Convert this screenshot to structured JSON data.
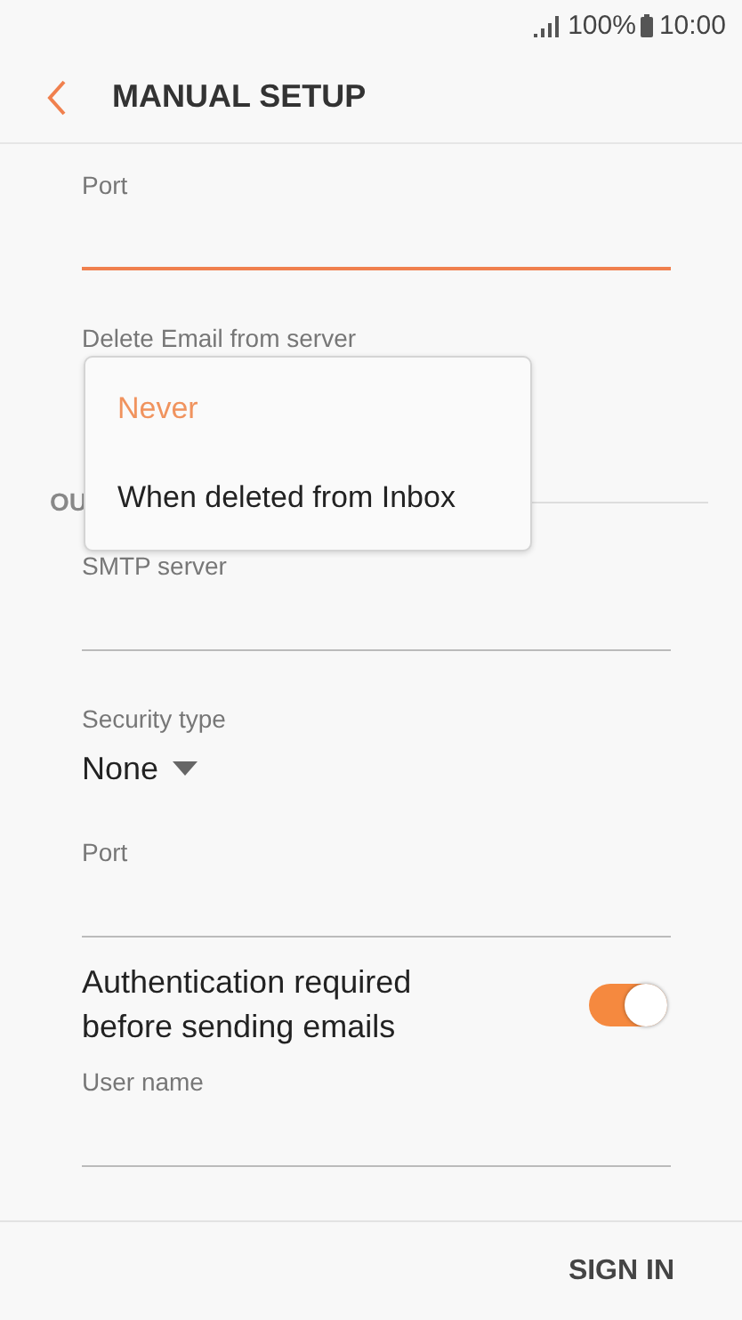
{
  "status_bar": {
    "battery": "100%",
    "time": "10:00"
  },
  "header": {
    "title": "MANUAL SETUP"
  },
  "fields": [
    {
      "kind": "text",
      "label": "Port",
      "focused": true
    },
    {
      "kind": "dropdown",
      "label": "Delete Email from server"
    },
    {
      "kind": "section",
      "label": "OU"
    },
    {
      "kind": "text",
      "label": "SMTP server",
      "focused": false
    },
    {
      "kind": "dropdown",
      "label": "Security type",
      "value": "None"
    },
    {
      "kind": "text",
      "label": "Port",
      "focused": false
    },
    {
      "kind": "switch",
      "label": "Authentication required before sending emails",
      "on": true
    },
    {
      "kind": "text",
      "label": "User name",
      "focused": false
    }
  ],
  "popup": {
    "options": [
      {
        "label": "Never",
        "selected": true
      },
      {
        "label": "When deleted from Inbox",
        "selected": false
      }
    ]
  },
  "footer": {
    "button": "SIGN IN"
  }
}
